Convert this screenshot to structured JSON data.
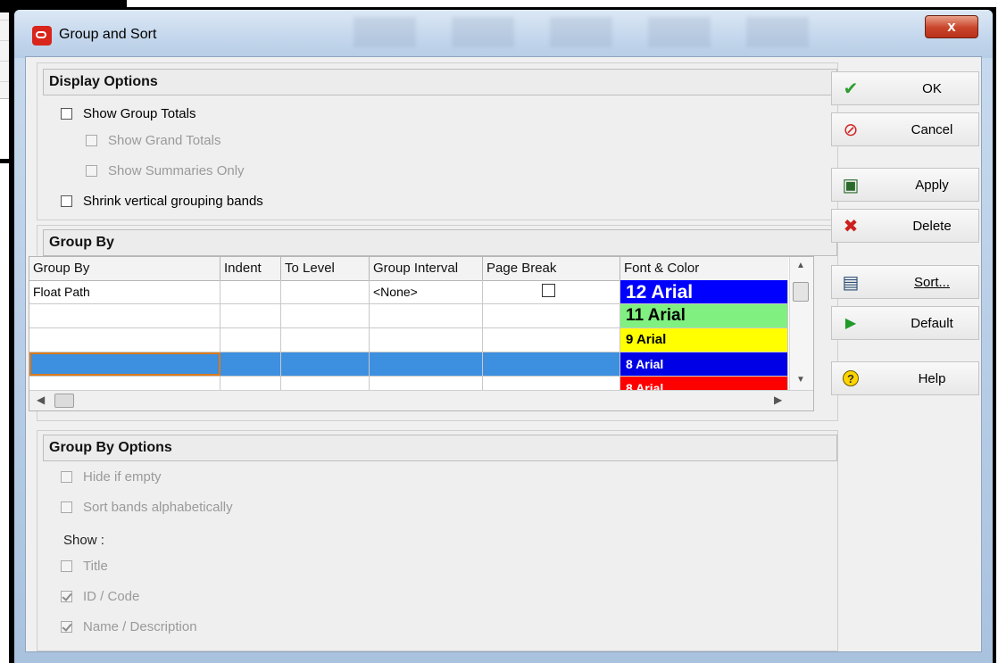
{
  "window": {
    "title": "Group and Sort",
    "close_glyph": "x"
  },
  "display_options": {
    "header": "Display Options",
    "show_group_totals": "Show Group Totals",
    "show_grand_totals": "Show Grand Totals",
    "show_summaries_only": "Show Summaries Only",
    "shrink_bands": "Shrink vertical grouping bands"
  },
  "group_by": {
    "header": "Group By",
    "columns": [
      "Group By",
      "Indent",
      "To Level",
      "Group Interval",
      "Page Break",
      "Font & Color"
    ],
    "rows": [
      {
        "group_by": "Float Path",
        "indent": "",
        "to_level": "",
        "interval": "<None>",
        "page_break": true,
        "font": "12 Arial",
        "font_bg": "#0000ff",
        "font_color": "#ffffff"
      },
      {
        "group_by": "",
        "indent": "",
        "to_level": "",
        "interval": "",
        "page_break": false,
        "font": "11 Arial",
        "font_bg": "#80f080",
        "font_color": "#000000"
      },
      {
        "group_by": "",
        "indent": "",
        "to_level": "",
        "interval": "",
        "page_break": false,
        "font": "9 Arial",
        "font_bg": "#ffff00",
        "font_color": "#000000"
      },
      {
        "group_by": "",
        "indent": "",
        "to_level": "",
        "interval": "",
        "page_break": false,
        "font": "8 Arial",
        "font_bg": "#0000e6",
        "font_color": "#ffffff"
      },
      {
        "group_by": "",
        "indent": "",
        "to_level": "",
        "interval": "",
        "page_break": false,
        "font": "8 Arial",
        "font_bg": "#ff0000",
        "font_color": "#ffffff"
      }
    ]
  },
  "group_by_options": {
    "header": "Group By Options",
    "hide_if_empty": "Hide if empty",
    "sort_alpha": "Sort bands alphabetically",
    "show_label": "Show :",
    "title": "Title",
    "id_code": "ID / Code",
    "name_desc": "Name / Description"
  },
  "buttons": {
    "ok": "OK",
    "cancel": "Cancel",
    "apply": "Apply",
    "delete": "Delete",
    "sort": "Sort...",
    "default": "Default",
    "help": "Help"
  },
  "icons": {
    "ok": "✔",
    "cancel": "⊘",
    "apply": "▣",
    "delete": "✖",
    "sort": "▤",
    "default": "▶",
    "help": "?"
  },
  "colors": {
    "ok_icon": "#2e9e2e",
    "cancel_icon": "#d42020",
    "delete_icon": "#cc2020",
    "default_icon": "#1f9a2a",
    "help_icon": "#e0b400",
    "selection": "#3d8fe0"
  }
}
